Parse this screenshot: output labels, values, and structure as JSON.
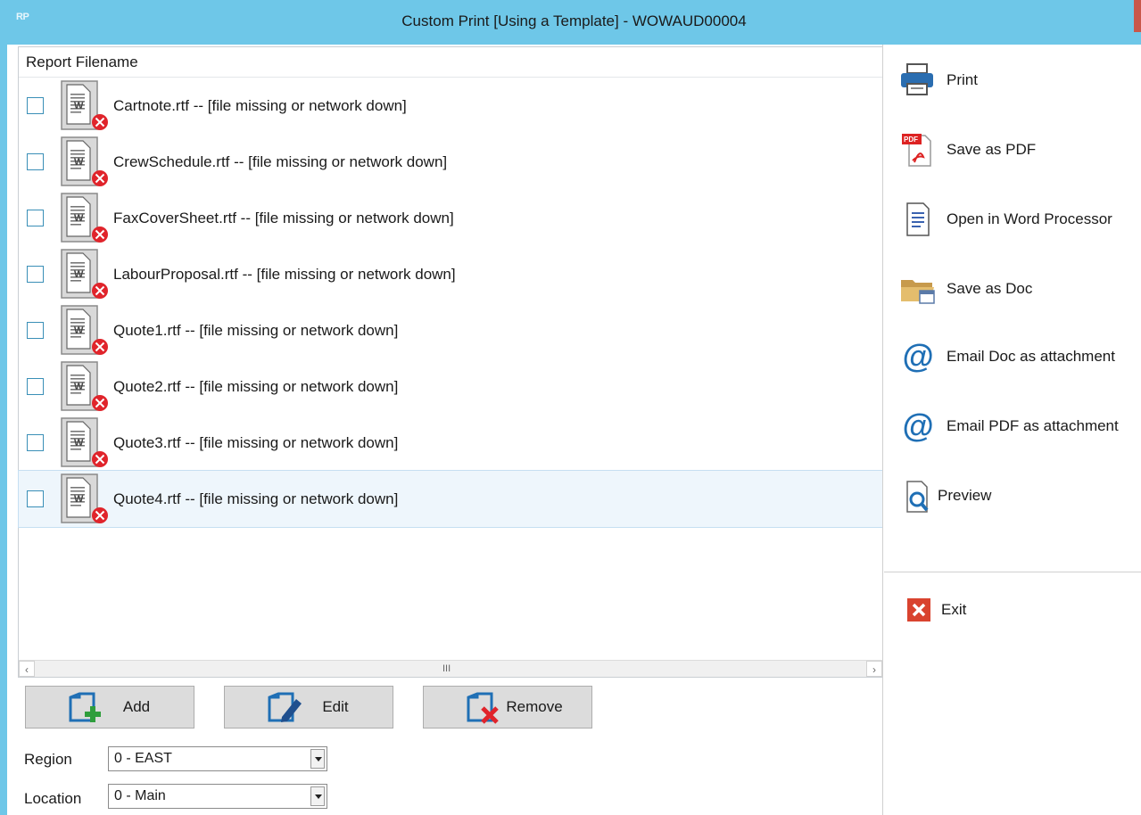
{
  "window": {
    "app_icon_text": "RP",
    "title": "Custom Print [Using a Template] - WOWAUD00004"
  },
  "list": {
    "header": "Report Filename",
    "rows": [
      {
        "label": "Cartnote.rtf -- [file missing or network down]",
        "checked": false
      },
      {
        "label": "CrewSchedule.rtf -- [file missing or network down]",
        "checked": false
      },
      {
        "label": "FaxCoverSheet.rtf -- [file missing or network down]",
        "checked": false
      },
      {
        "label": "LabourProposal.rtf -- [file missing or network down]",
        "checked": false
      },
      {
        "label": "Quote1.rtf -- [file missing or network down]",
        "checked": false
      },
      {
        "label": "Quote2.rtf -- [file missing or network down]",
        "checked": false
      },
      {
        "label": "Quote3.rtf -- [file missing or network down]",
        "checked": false
      },
      {
        "label": "Quote4.rtf -- [file missing or network down]",
        "checked": false,
        "selected": true
      }
    ],
    "scroll_grip": "III"
  },
  "buttons": {
    "add": "Add",
    "edit": "Edit",
    "remove": "Remove"
  },
  "fields": {
    "region_label": "Region",
    "region_value": "0 - EAST",
    "location_label": "Location",
    "location_value": "0 - Main"
  },
  "actions": {
    "print": "Print",
    "save_pdf": "Save as PDF",
    "open_word": "Open in Word Processor",
    "save_doc": "Save as Doc",
    "email_doc": "Email Doc as attachment",
    "email_pdf": "Email PDF as attachment",
    "preview": "Preview",
    "exit": "Exit"
  },
  "colors": {
    "titlebar": "#6ec7e8",
    "accent_blue": "#1f6fb5",
    "error_red": "#e0242b",
    "exit_red": "#d9432f"
  },
  "icons": {
    "row_file": "word-document-missing-icon",
    "add": "add-document-icon",
    "edit": "edit-document-icon",
    "remove": "remove-document-icon",
    "print": "printer-icon",
    "save_pdf": "pdf-icon",
    "open_word": "word-document-icon",
    "save_doc": "folder-icon",
    "email": "at-sign-icon",
    "preview": "preview-magnifier-icon",
    "exit": "close-icon"
  }
}
